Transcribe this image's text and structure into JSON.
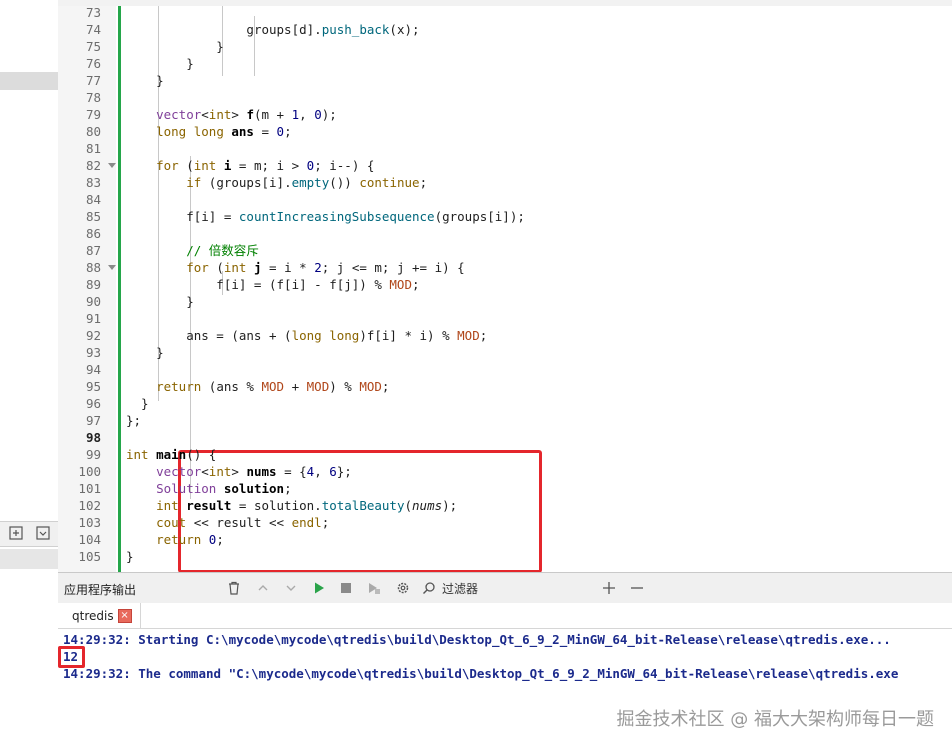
{
  "editor": {
    "lines": [
      {
        "n": "73",
        "html": ""
      },
      {
        "n": "74",
        "html": "                <span data-name=\"v\">groups</span>[d].<span class=\"fn\">push_back</span>(x);"
      },
      {
        "n": "75",
        "html": "            }"
      },
      {
        "n": "76",
        "html": "        }"
      },
      {
        "n": "77",
        "html": "    }"
      },
      {
        "n": "78",
        "html": ""
      },
      {
        "n": "79",
        "html": "    <span class=\"ty\">vector</span>&lt;<span class=\"kw\">int</span>&gt; <span class=\"b\">f</span>(m + <span class=\"num\">1</span>, <span class=\"num\">0</span>);"
      },
      {
        "n": "80",
        "html": "    <span class=\"kw\">long long</span> <span class=\"b\">ans</span> = <span class=\"num\">0</span>;"
      },
      {
        "n": "81",
        "html": ""
      },
      {
        "n": "82",
        "html": "    <span class=\"kw\">for</span> (<span class=\"kw\">int</span> <span class=\"b\">i</span> = m; i &gt; <span class=\"num\">0</span>; i--) {"
      },
      {
        "n": "83",
        "html": "        <span class=\"kw\">if</span> (groups[i].<span class=\"fn\">empty</span>()) <span class=\"kw\">continue</span>;"
      },
      {
        "n": "84",
        "html": ""
      },
      {
        "n": "85",
        "html": "        f[i] = <span class=\"fn\">countIncreasingSubsequence</span>(groups[i]);"
      },
      {
        "n": "86",
        "html": ""
      },
      {
        "n": "87",
        "html": "        <span class=\"cm\">// 倍数容斥</span>"
      },
      {
        "n": "88",
        "html": "        <span class=\"kw\">for</span> (<span class=\"kw\">int</span> <span class=\"b\">j</span> = i * <span class=\"num\">2</span>; j &lt;= m; j += i) {"
      },
      {
        "n": "89",
        "html": "            f[i] = (f[i] - f[j]) % <span class=\"mac\">MOD</span>;"
      },
      {
        "n": "90",
        "html": "        }"
      },
      {
        "n": "91",
        "html": ""
      },
      {
        "n": "92",
        "html": "        ans = (ans + (<span class=\"kw\">long long</span>)f[i] * i) % <span class=\"mac\">MOD</span>;"
      },
      {
        "n": "93",
        "html": "    }"
      },
      {
        "n": "94",
        "html": ""
      },
      {
        "n": "95",
        "html": "    <span class=\"kw\">return</span> (ans % <span class=\"mac\">MOD</span> + <span class=\"mac\">MOD</span>) % <span class=\"mac\">MOD</span>;"
      },
      {
        "n": "96",
        "html": "  }"
      },
      {
        "n": "97",
        "html": "};"
      },
      {
        "n": "98",
        "html": ""
      },
      {
        "n": "99",
        "html": "<span class=\"kw\">int</span> <span class=\"b\">main</span>() {"
      },
      {
        "n": "100",
        "html": "    <span class=\"ty\">vector</span>&lt;<span class=\"kw\">int</span>&gt; <span class=\"b\">nums</span> = {<span class=\"num\">4</span>, <span class=\"num\">6</span>};"
      },
      {
        "n": "101",
        "html": "    <span class=\"ty\">Solution</span> <span class=\"b\">solution</span>;"
      },
      {
        "n": "102",
        "html": "    <span class=\"kw\">int</span> <span class=\"b\">result</span> = solution.<span class=\"fn\">totalBeauty</span>(<span class=\"it\">nums</span>);"
      },
      {
        "n": "103",
        "html": "    <span class=\"kw\">cout</span> &lt;&lt; result &lt;&lt; <span class=\"kw\">endl</span>;"
      },
      {
        "n": "104",
        "html": "    <span class=\"kw\">return</span> <span class=\"num\">0</span>;"
      },
      {
        "n": "105",
        "html": "}"
      }
    ],
    "current_line": "98",
    "fold_markers": [
      "82",
      "88"
    ]
  },
  "output": {
    "title": "应用程序输出",
    "filter_label": "过滤器",
    "tab_label": "qtredis",
    "tab_close": "×",
    "lines": [
      "14:29:32: Starting C:\\mycode\\mycode\\qtredis\\build\\Desktop_Qt_6_9_2_MinGW_64_bit-Release\\release\\qtredis.exe...",
      "12",
      "14:29:32: The command \"C:\\mycode\\mycode\\qtredis\\build\\Desktop_Qt_6_9_2_MinGW_64_bit-Release\\release\\qtredis.exe"
    ]
  },
  "watermark": "掘金技术社区 @ 福大大架构师每日一题",
  "colors": {
    "highlight_box": "#e4262c",
    "modified_bar": "#24a64a",
    "output_text": "#1b2a8c"
  },
  "icons": [
    "trash-icon",
    "up-icon",
    "down-icon",
    "run-icon",
    "stop-icon",
    "attach-icon",
    "settings-icon",
    "search-icon",
    "plus-icon",
    "minus-icon",
    "add-split-icon",
    "close-split-icon"
  ]
}
